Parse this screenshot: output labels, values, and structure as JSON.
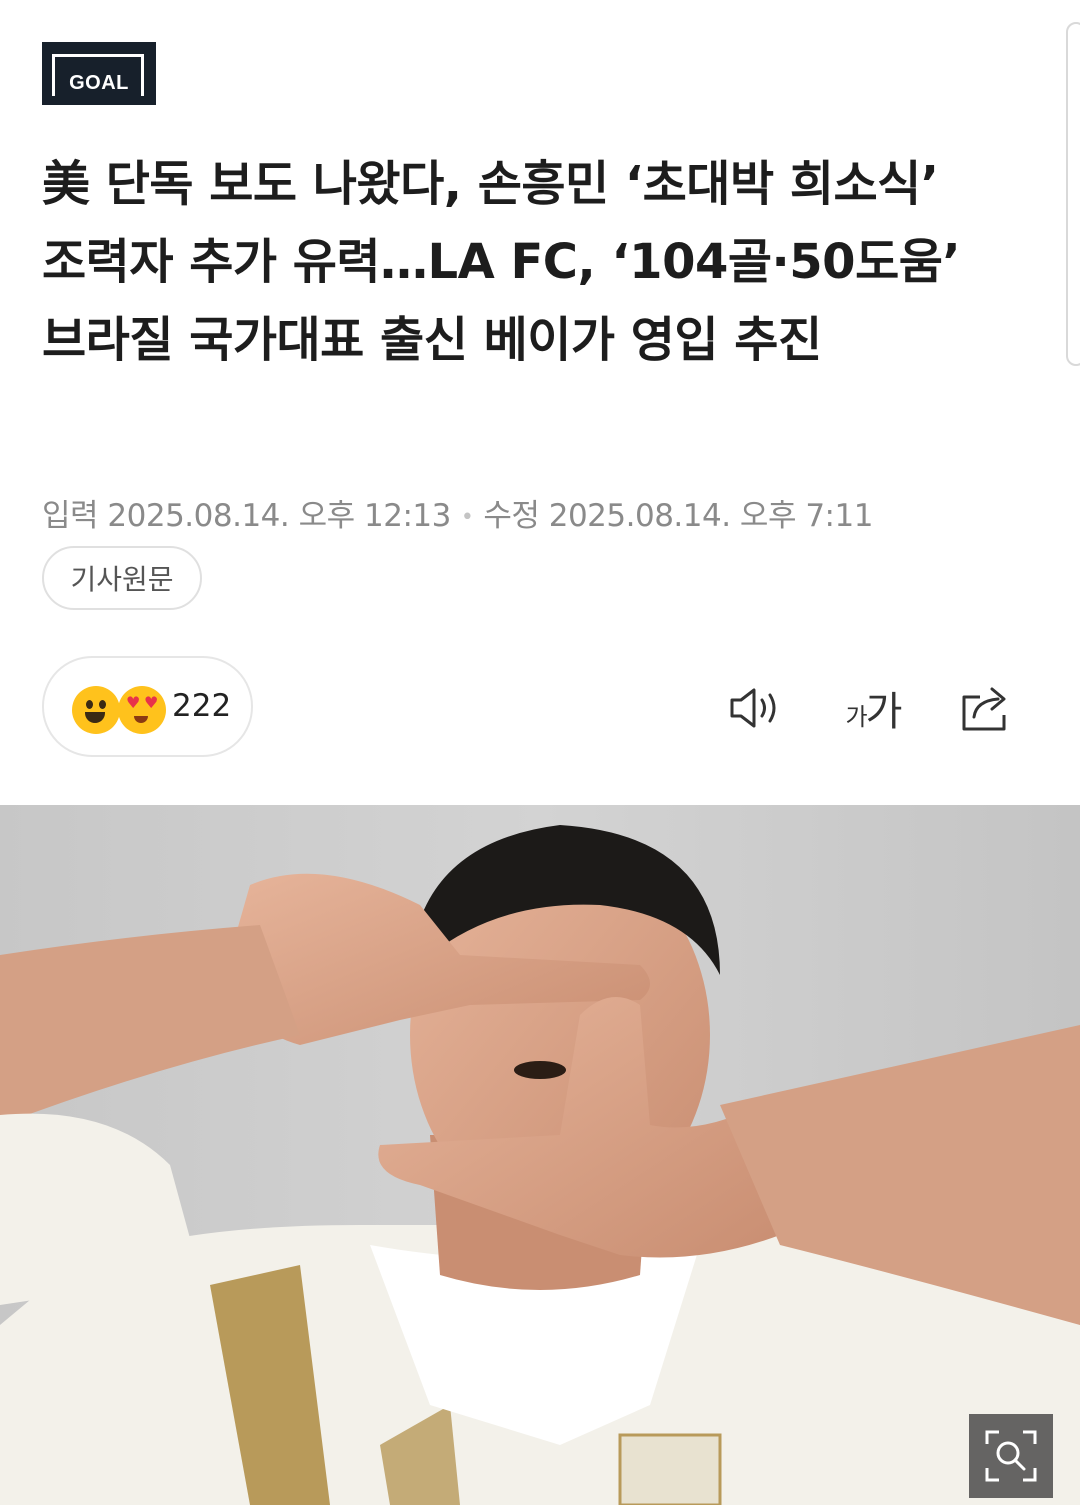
{
  "source": {
    "logo_text": "GOAL"
  },
  "article": {
    "headline": "美 단독 보도 나왔다, 손흥민 ‘초대박 희소식’ 조력자 추가 유력…LA FC, ‘104골·50도움’ 브라질 국가대표 출신 베이가 영입 추진",
    "input_label": "입력",
    "input_time": "2025.08.14. 오후 12:13",
    "separator": "•",
    "modified_label": "수정",
    "modified_time": "2025.08.14. 오후 7:11",
    "original_button": "기사원문"
  },
  "toolbar": {
    "reaction_count": "222",
    "font_small": "가",
    "font_large": "가",
    "icons": [
      "speaker-icon",
      "font-size-icon",
      "share-icon"
    ]
  },
  "photo": {
    "zoom_icon": "zoom-search-icon"
  },
  "colors": {
    "logo_bg": "#17202b",
    "headline": "#1d1d1d",
    "meta": "#8a8a8a",
    "emoji": "#ffc21c",
    "jersey_gold": "#b89a5a"
  }
}
